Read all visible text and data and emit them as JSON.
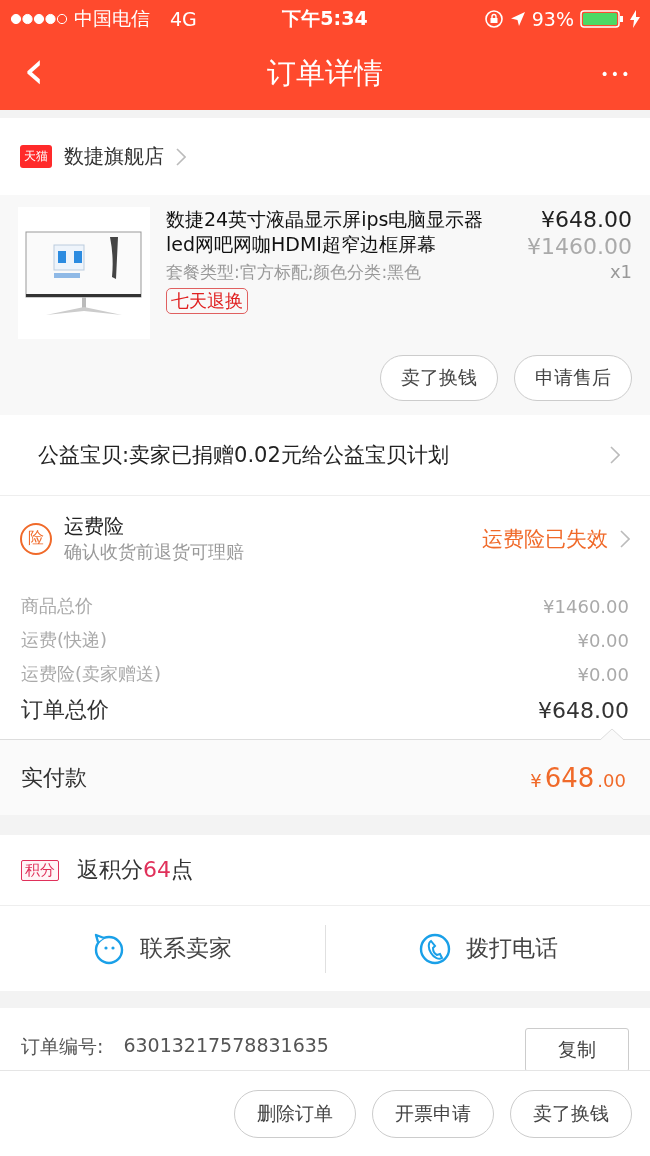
{
  "status_bar": {
    "carrier": "中国电信",
    "network": "4G",
    "time": "下午5:34",
    "battery": "93%"
  },
  "nav": {
    "back": "‹",
    "title": "订单详情",
    "more": "•••"
  },
  "store": {
    "badge": "天猫",
    "name": "数捷旗舰店"
  },
  "product": {
    "kind": "picture",
    "title": "数捷24英寸液晶显示屏ips电脑显示器led网吧网咖HDMI超窄边框屏幕",
    "specs": "套餐类型:官方标配;颜色分类:黑色",
    "tag": "七天退换",
    "price": "¥648.00",
    "original_price": "¥1460.00",
    "quantity": "x1",
    "buttons": [
      "卖了换钱",
      "申请售后"
    ]
  },
  "charity": {
    "text": "公益宝贝:卖家已捐赠0.02元给公益宝贝计划"
  },
  "insurance": {
    "icon": "险",
    "title": "运费险",
    "subtitle": "确认收货前退货可理赔",
    "status": "运费险已失效"
  },
  "price_rows": [
    {
      "label": "商品总价",
      "value": "¥1460.00",
      "kind": "minor"
    },
    {
      "label": "运费(快递)",
      "value": "¥0.00",
      "kind": "minor"
    },
    {
      "label": "运费险(卖家赠送)",
      "value": "¥0.00",
      "kind": "minor"
    },
    {
      "label": "订单总价",
      "value": "¥648.00",
      "kind": "total"
    }
  ],
  "paid": {
    "label": "实付款",
    "currency": "¥",
    "integer": "648",
    "decimal": ".00"
  },
  "points": {
    "badge": "积分",
    "before": "返积分",
    "amount": "64",
    "after": "点"
  },
  "contact": [
    {
      "label": "联系卖家",
      "kind": "chat"
    },
    {
      "label": "拨打电话",
      "kind": "phone"
    }
  ],
  "order": {
    "label": "订单编号:",
    "number": "63013217578831635",
    "copy": "复制"
  },
  "bottom_buttons": [
    "删除订单",
    "开票申请",
    "卖了换钱"
  ]
}
